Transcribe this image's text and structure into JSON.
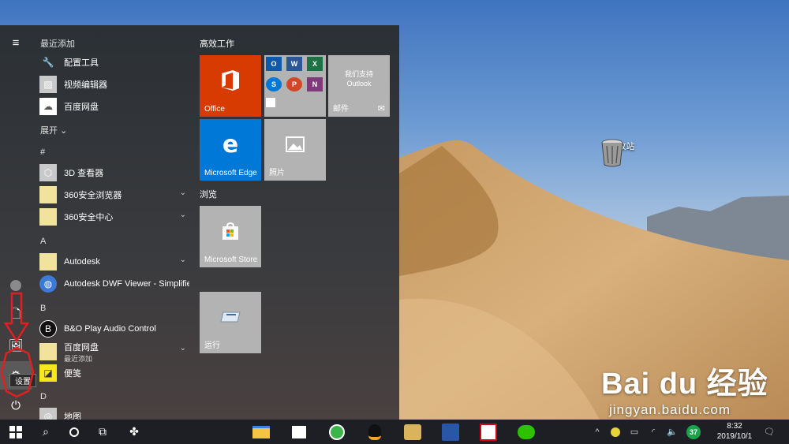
{
  "desktop": {
    "recycle_bin_label": "回收站",
    "watermark_logo": "Bai du 经验",
    "watermark_url": "jingyan.baidu.com"
  },
  "start_menu": {
    "recently_added_header": "最近添加",
    "expand_label": "展开",
    "sections": [
      "#",
      "A",
      "B",
      "D"
    ],
    "apps": [
      {
        "label": "配置工具",
        "icon": "tools-icon"
      },
      {
        "label": "视频编辑器",
        "icon": "photo-icon"
      },
      {
        "label": "百度网盘",
        "icon": "baidu-netdisk-icon"
      },
      {
        "label": "3D 查看器",
        "icon": "cube-icon"
      },
      {
        "label": "360安全浏览器",
        "icon": "folder-icon"
      },
      {
        "label": "360安全中心",
        "icon": "folder-icon"
      },
      {
        "label": "Autodesk",
        "icon": "folder-icon"
      },
      {
        "label": "Autodesk DWF Viewer - Simplifie...",
        "icon": "globe-icon"
      },
      {
        "label": "B&O Play Audio Control",
        "icon": "bo-icon"
      },
      {
        "label": "百度网盘",
        "sublabel": "最近添加",
        "icon": "folder-icon"
      },
      {
        "label": "便笺",
        "icon": "sticky-note-icon"
      },
      {
        "label": "地图",
        "icon": "map-icon"
      }
    ],
    "settings_tooltip": "设置",
    "tile_groups": [
      "高效工作",
      "浏览"
    ],
    "tiles": {
      "office": "Office",
      "outlook_line1": "我们支持",
      "outlook_line2": "Outlook",
      "mail": "邮件",
      "edge": "Microsoft Edge",
      "photos": "照片",
      "store": "Microsoft Store",
      "run": "运行"
    },
    "mini_tiles": [
      "O",
      "W",
      "X",
      "S",
      "P",
      "N"
    ]
  },
  "taskbar": {
    "badge_count": "37",
    "time": "8:32",
    "date": "2019/10/1"
  },
  "colors": {
    "office_tile": "#d83b01",
    "edge_tile": "#0078d7",
    "gray_tile": "#b3b3b3",
    "taskbar": "#1d1f24",
    "annotation": "#e02020"
  }
}
